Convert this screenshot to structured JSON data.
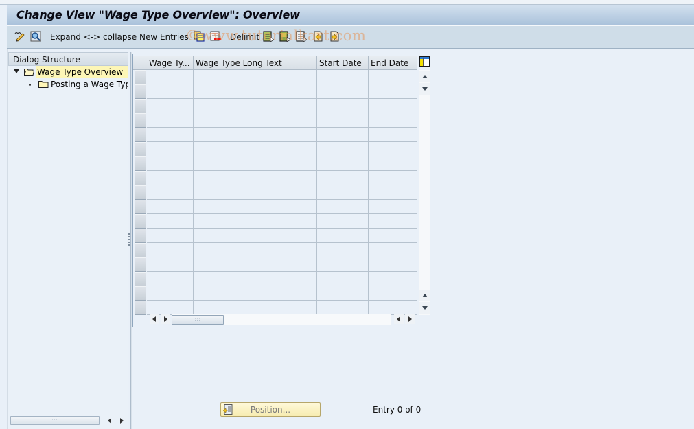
{
  "window": {
    "title": "Change View \"Wage Type Overview\": Overview"
  },
  "toolbar": {
    "items": [
      {
        "type": "icon",
        "name": "display-change-icon"
      },
      {
        "type": "icon",
        "name": "find-icon"
      },
      {
        "type": "text",
        "label": "Expand <-> collapse"
      },
      {
        "type": "text",
        "label": "New Entries"
      },
      {
        "type": "icon",
        "name": "copy-as-icon"
      },
      {
        "type": "icon",
        "name": "delete-icon"
      },
      {
        "type": "text",
        "label": "Delimit"
      },
      {
        "type": "icon",
        "name": "select-all-icon"
      },
      {
        "type": "icon",
        "name": "select-block-icon"
      },
      {
        "type": "icon",
        "name": "deselect-all-icon"
      },
      {
        "type": "icon",
        "name": "previous-entry-icon"
      },
      {
        "type": "icon",
        "name": "next-entry-icon"
      }
    ],
    "expand_collapse_label": "Expand <-> collapse",
    "new_entries_label": "New Entries",
    "delimit_label": "Delimit",
    "watermark": "©www.tutorialkart.com"
  },
  "dialog_structure": {
    "header": "Dialog Structure",
    "nodes": [
      {
        "label": "Wage Type Overview",
        "level": 0,
        "expanded": true,
        "selected": true,
        "icon": "folder-open-icon"
      },
      {
        "label": "Posting a Wage Type",
        "level": 1,
        "expanded": false,
        "selected": false,
        "icon": "folder-icon"
      }
    ]
  },
  "table": {
    "columns": [
      {
        "key": "wage_type",
        "label": "Wage Ty..."
      },
      {
        "key": "long_text",
        "label": "Wage Type Long Text"
      },
      {
        "key": "start_date",
        "label": "Start Date"
      },
      {
        "key": "end_date",
        "label": "End Date"
      }
    ],
    "rows": [
      {
        "wage_type": "",
        "long_text": "",
        "start_date": "",
        "end_date": ""
      },
      {
        "wage_type": "",
        "long_text": "",
        "start_date": "",
        "end_date": ""
      },
      {
        "wage_type": "",
        "long_text": "",
        "start_date": "",
        "end_date": ""
      },
      {
        "wage_type": "",
        "long_text": "",
        "start_date": "",
        "end_date": ""
      },
      {
        "wage_type": "",
        "long_text": "",
        "start_date": "",
        "end_date": ""
      },
      {
        "wage_type": "",
        "long_text": "",
        "start_date": "",
        "end_date": ""
      },
      {
        "wage_type": "",
        "long_text": "",
        "start_date": "",
        "end_date": ""
      },
      {
        "wage_type": "",
        "long_text": "",
        "start_date": "",
        "end_date": ""
      },
      {
        "wage_type": "",
        "long_text": "",
        "start_date": "",
        "end_date": ""
      },
      {
        "wage_type": "",
        "long_text": "",
        "start_date": "",
        "end_date": ""
      },
      {
        "wage_type": "",
        "long_text": "",
        "start_date": "",
        "end_date": ""
      },
      {
        "wage_type": "",
        "long_text": "",
        "start_date": "",
        "end_date": ""
      },
      {
        "wage_type": "",
        "long_text": "",
        "start_date": "",
        "end_date": ""
      },
      {
        "wage_type": "",
        "long_text": "",
        "start_date": "",
        "end_date": ""
      },
      {
        "wage_type": "",
        "long_text": "",
        "start_date": "",
        "end_date": ""
      },
      {
        "wage_type": "",
        "long_text": "",
        "start_date": "",
        "end_date": ""
      },
      {
        "wage_type": "",
        "long_text": "",
        "start_date": "",
        "end_date": ""
      }
    ]
  },
  "footer": {
    "position_button": "Position...",
    "entry_text": "Entry 0 of 0"
  }
}
